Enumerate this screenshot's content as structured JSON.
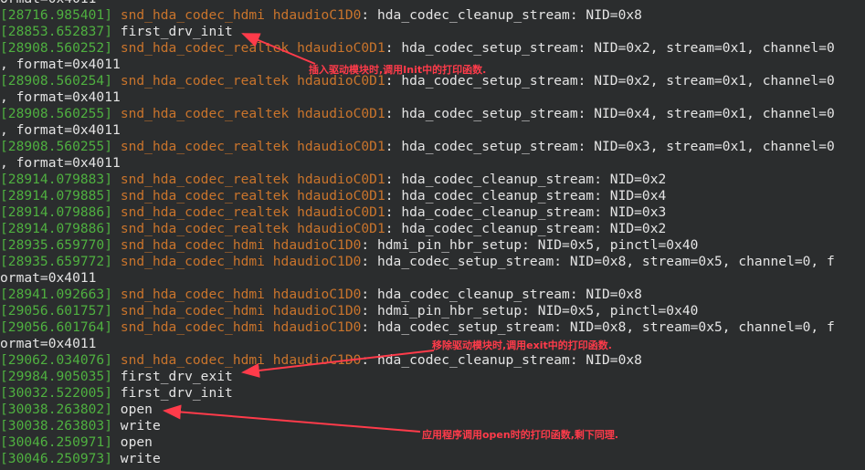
{
  "terminal": {
    "lines": [
      {
        "msg": "ormat=0x4011"
      },
      {
        "ts": "[28716.985401]",
        "mod": "snd_hda_codec_hdmi hdaudioC1D0",
        "msg": ": hda_codec_cleanup_stream: NID=0x8"
      },
      {
        "ts": "[28853.652837]",
        "msg": " first_drv_init"
      },
      {
        "ts": "[28908.560252]",
        "mod": "snd_hda_codec_realtek hdaudioC0D1",
        "msg": ": hda_codec_setup_stream: NID=0x2, stream=0x1, channel=0"
      },
      {
        "msg": ", format=0x4011"
      },
      {
        "ts": "[28908.560254]",
        "mod": "snd_hda_codec_realtek hdaudioC0D1",
        "msg": ": hda_codec_setup_stream: NID=0x2, stream=0x1, channel=0"
      },
      {
        "msg": ", format=0x4011"
      },
      {
        "ts": "[28908.560255]",
        "mod": "snd_hda_codec_realtek hdaudioC0D1",
        "msg": ": hda_codec_setup_stream: NID=0x4, stream=0x1, channel=0"
      },
      {
        "msg": ", format=0x4011"
      },
      {
        "ts": "[28908.560255]",
        "mod": "snd_hda_codec_realtek hdaudioC0D1",
        "msg": ": hda_codec_setup_stream: NID=0x3, stream=0x1, channel=0"
      },
      {
        "msg": ", format=0x4011"
      },
      {
        "ts": "[28914.079883]",
        "mod": "snd_hda_codec_realtek hdaudioC0D1",
        "msg": ": hda_codec_cleanup_stream: NID=0x2"
      },
      {
        "ts": "[28914.079885]",
        "mod": "snd_hda_codec_realtek hdaudioC0D1",
        "msg": ": hda_codec_cleanup_stream: NID=0x4"
      },
      {
        "ts": "[28914.079886]",
        "mod": "snd_hda_codec_realtek hdaudioC0D1",
        "msg": ": hda_codec_cleanup_stream: NID=0x3"
      },
      {
        "ts": "[28914.079886]",
        "mod": "snd_hda_codec_realtek hdaudioC0D1",
        "msg": ": hda_codec_cleanup_stream: NID=0x2"
      },
      {
        "ts": "[28935.659770]",
        "mod": "snd_hda_codec_hdmi hdaudioC1D0",
        "msg": ": hdmi_pin_hbr_setup: NID=0x5, pinctl=0x40"
      },
      {
        "ts": "[28935.659772]",
        "mod": "snd_hda_codec_hdmi hdaudioC1D0",
        "msg": ": hda_codec_setup_stream: NID=0x8, stream=0x5, channel=0, f"
      },
      {
        "msg": "ormat=0x4011"
      },
      {
        "ts": "[28941.092663]",
        "mod": "snd_hda_codec_hdmi hdaudioC1D0",
        "msg": ": hda_codec_cleanup_stream: NID=0x8"
      },
      {
        "ts": "[29056.601757]",
        "mod": "snd_hda_codec_hdmi hdaudioC1D0",
        "msg": ": hdmi_pin_hbr_setup: NID=0x5, pinctl=0x40"
      },
      {
        "ts": "[29056.601764]",
        "mod": "snd_hda_codec_hdmi hdaudioC1D0",
        "msg": ": hda_codec_setup_stream: NID=0x8, stream=0x5, channel=0, f"
      },
      {
        "msg": "ormat=0x4011"
      },
      {
        "ts": "[29062.034076]",
        "mod": "snd_hda_codec_hdmi hdaudioC1D0",
        "msg": ": hda_codec_cleanup_stream: NID=0x8"
      },
      {
        "ts": "[29984.905035]",
        "msg": " first_drv_exit"
      },
      {
        "ts": "[30032.522005]",
        "msg": " first_drv_init"
      },
      {
        "ts": "[30038.263802]",
        "msg": " open"
      },
      {
        "ts": "[30038.263803]",
        "msg": " write"
      },
      {
        "ts": "[30046.250971]",
        "msg": " open"
      },
      {
        "ts": "[30046.250973]",
        "msg": " write"
      }
    ]
  },
  "annotations": {
    "note1": "插入驱动模块时,调用Init中的打印函数.",
    "note2": "移除驱动模块时,调用exit中的打印函数.",
    "note3": "应用程序调用open时的打印函数,剩下同理.",
    "color": "#ff3b4a"
  }
}
